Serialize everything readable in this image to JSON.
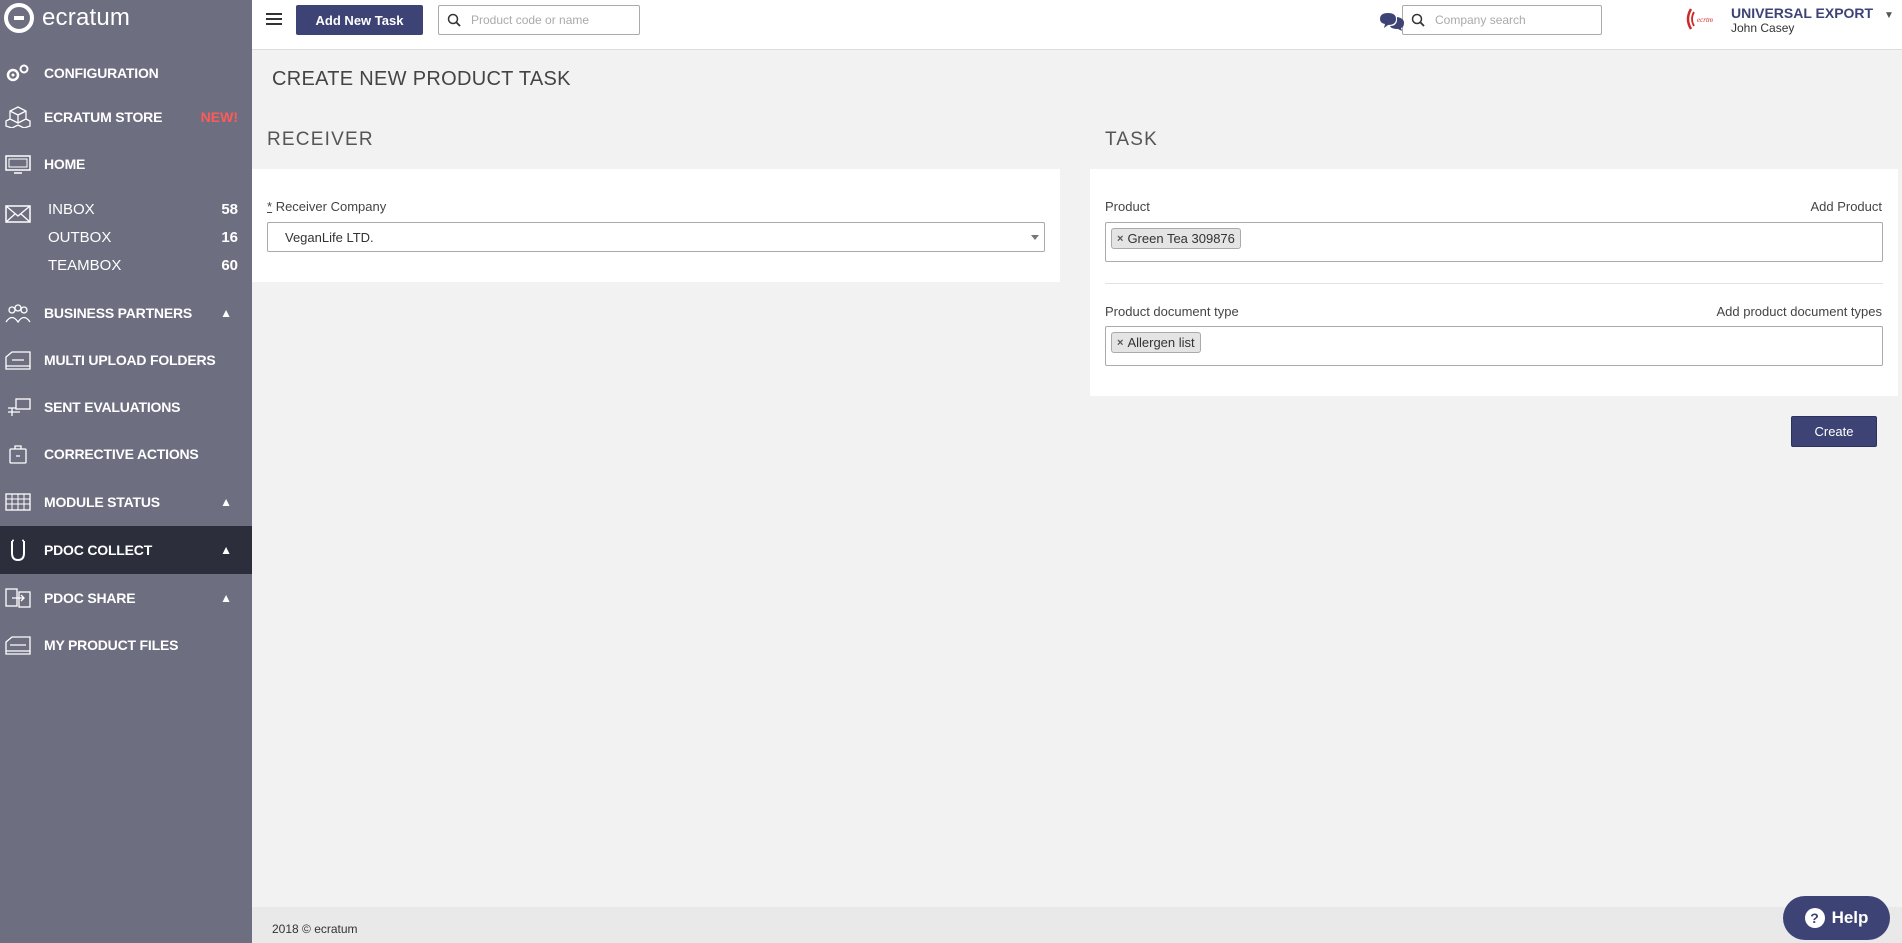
{
  "brand": {
    "name": "ecratum"
  },
  "sidebar": {
    "items": [
      {
        "label": "CONFIGURATION",
        "icon": "gears-icon"
      },
      {
        "label": "ECRATUM STORE",
        "icon": "cubes-icon",
        "badge": "NEW!"
      },
      {
        "label": "HOME",
        "icon": "monitor-icon"
      },
      {
        "label": "BUSINESS PARTNERS",
        "icon": "people-icon",
        "expandable": true
      },
      {
        "label": "MULTI UPLOAD FOLDERS",
        "icon": "folders-icon"
      },
      {
        "label": "SENT EVALUATIONS",
        "icon": "evaluation-icon"
      },
      {
        "label": "CORRECTIVE ACTIONS",
        "icon": "briefcase-icon"
      },
      {
        "label": "MODULE STATUS",
        "icon": "grid-icon",
        "expandable": true
      },
      {
        "label": "PDOC COLLECT",
        "icon": "magnet-icon",
        "expandable": true,
        "active": true
      },
      {
        "label": "PDOC SHARE",
        "icon": "share-icon",
        "expandable": true
      },
      {
        "label": "MY PRODUCT FILES",
        "icon": "files-icon"
      }
    ],
    "mail": [
      {
        "label": "INBOX",
        "count": "58"
      },
      {
        "label": "OUTBOX",
        "count": "16"
      },
      {
        "label": "TEAMBOX",
        "count": "60"
      }
    ]
  },
  "topbar": {
    "add_task_label": "Add New Task",
    "product_search_placeholder": "Product code or name",
    "company_search_placeholder": "Company search",
    "company_name": "UNIVERSAL EXPORT",
    "user_name": "John Casey"
  },
  "main": {
    "page_title": "CREATE NEW PRODUCT TASK",
    "receiver": {
      "header": "RECEIVER",
      "company_label": "Receiver Company",
      "required_mark": "*",
      "company_value": "VeganLife LTD."
    },
    "task": {
      "header": "TASK",
      "product_label": "Product",
      "add_product_label": "Add Product",
      "product_tags": [
        "Green Tea 309876"
      ],
      "doc_type_label": "Product document type",
      "add_doc_type_label": "Add product document types",
      "doc_type_tags": [
        "Allergen list"
      ]
    },
    "create_label": "Create"
  },
  "footer": {
    "text": "2018 © ecratum"
  },
  "help": {
    "label": "Help",
    "icon_glyph": "?"
  },
  "colors": {
    "sidebar_bg": "#6d6e80",
    "sidebar_active": "#2d2e3c",
    "accent": "#3d4475",
    "new_badge": "#ff5a5a",
    "page_bg": "#f2f2f2"
  }
}
